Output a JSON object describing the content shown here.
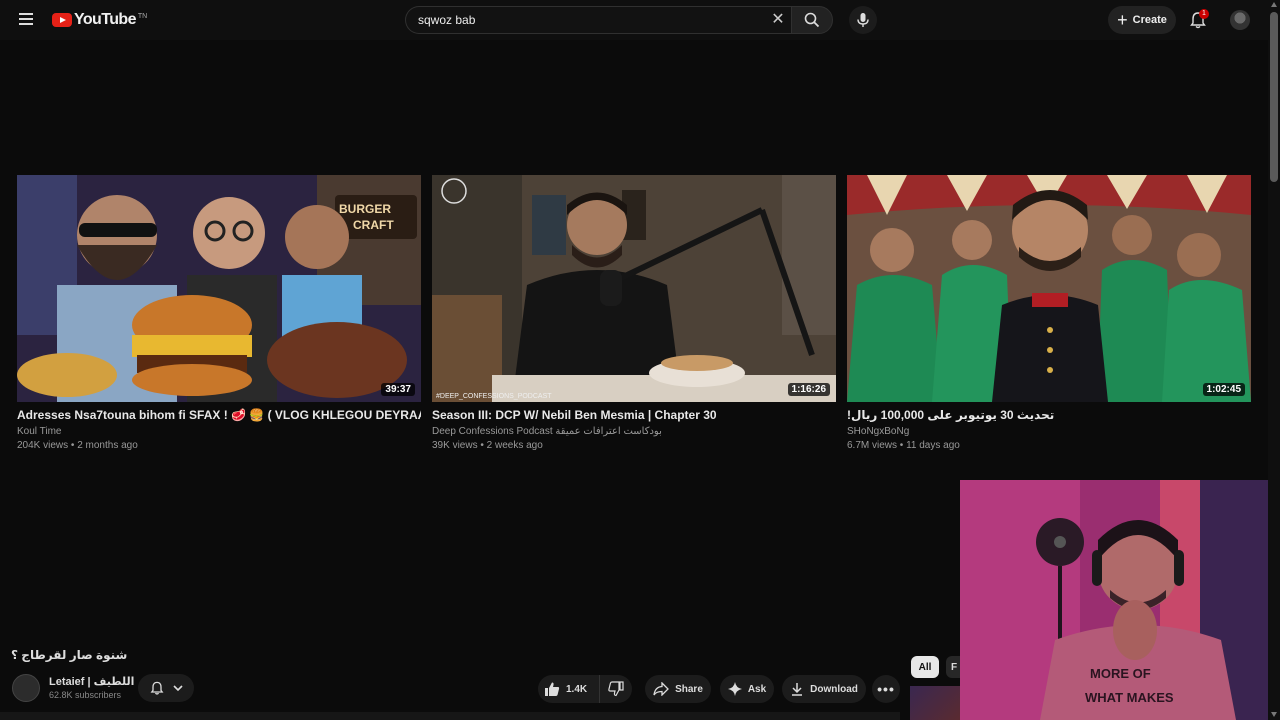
{
  "header": {
    "logo_text": "YouTube",
    "logo_region": "TN",
    "search_value": "sqwoz bab",
    "create_label": "Create",
    "notification_count": "1"
  },
  "videos": [
    {
      "title": "Adresses Nsa7touna bihom fi SFAX ! 🥩 🍔 ( VLOG KHLEGOU DEYRAAA !)",
      "channel": "Koul Time",
      "meta": "204K views • 2 months ago",
      "duration": "39:37",
      "thumb_text": "BURGER CRAFT"
    },
    {
      "title": "Season III: DCP W/ Nebil Ben Mesmia | Chapter 30",
      "channel": "Deep Confessions Podcast بودكاست اعترافات عميقة",
      "meta": "39K views • 2 weeks ago",
      "duration": "1:16:26",
      "thumb_text": "#DEEP_CONFESSIONS_PODCAST"
    },
    {
      "title": "تحديث 30 يوتيوبر على 100,000 ريال!",
      "channel": "SHoNgxBoNg",
      "meta": "6.7M views • 11 days ago",
      "duration": "1:02:45"
    }
  ],
  "watch": {
    "title": "شنوة صار لقرطاج ؟",
    "channel_name": "Letaief | اللطيف",
    "subscribers": "62.8K subscribers",
    "likes": "1.4K",
    "share_label": "Share",
    "ask_label": "Ask",
    "download_label": "Download"
  },
  "chips": {
    "all": "All",
    "next": "F"
  },
  "webcam": {
    "shirt_text_1": "MORE OF",
    "shirt_text_2": "WHAT MAKES"
  },
  "colors": {
    "logo_red": "#e62117",
    "badge_red": "#cc0000",
    "background": "#0b0b0b"
  }
}
